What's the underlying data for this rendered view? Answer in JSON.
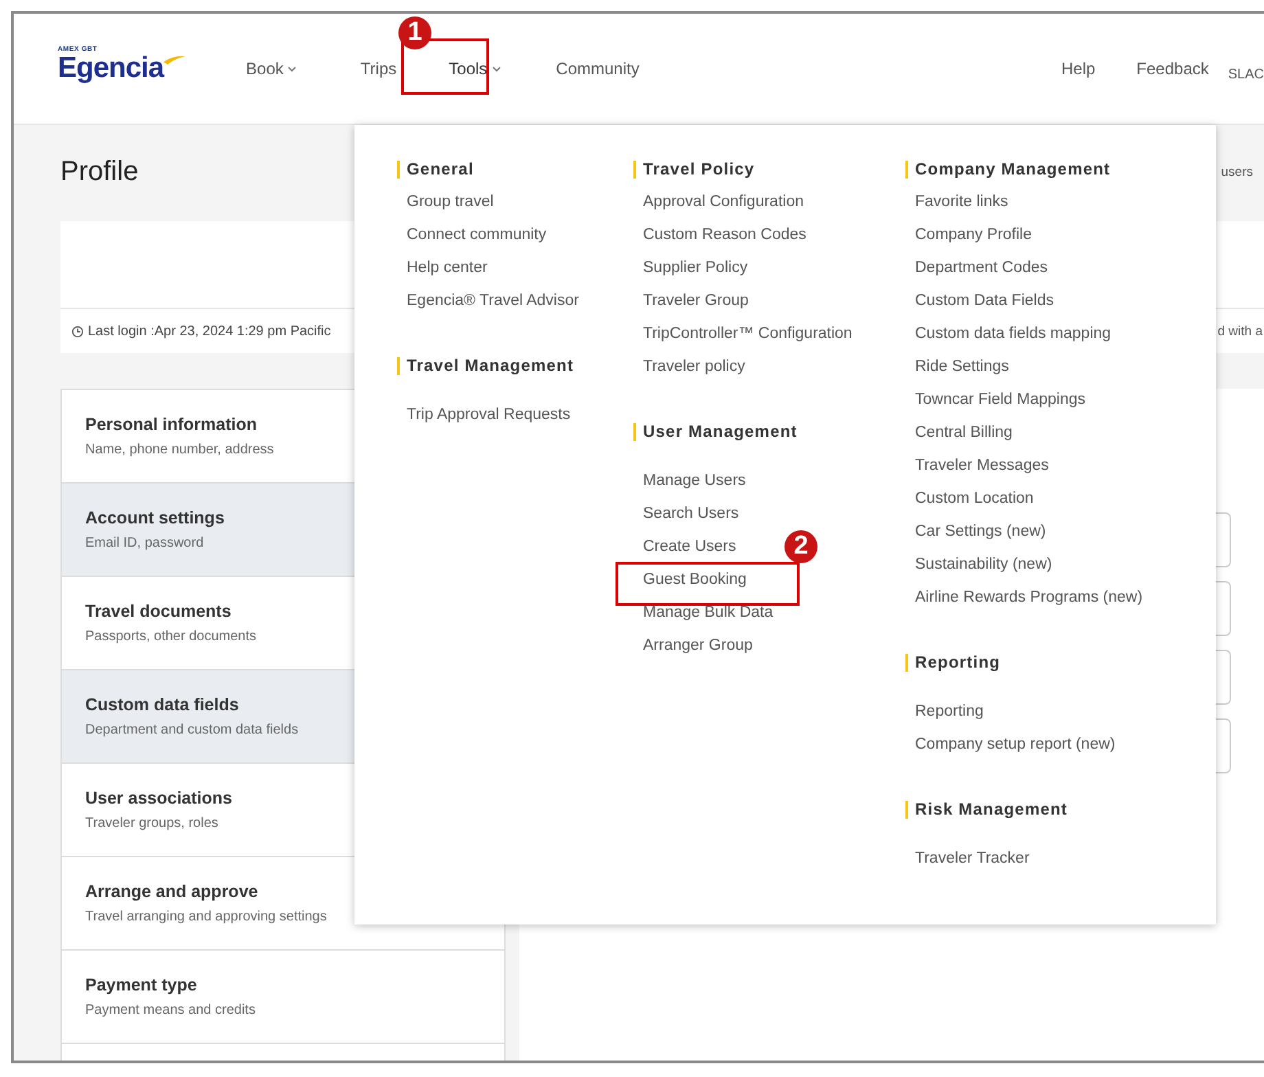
{
  "header": {
    "logo": {
      "tagline": "AMEX GBT",
      "name": "Egencia"
    },
    "nav": [
      {
        "label": "Book",
        "dropdown": true,
        "selected": false
      },
      {
        "label": "Trips",
        "dropdown": false,
        "selected": false
      },
      {
        "label": "Tools",
        "dropdown": true,
        "selected": true
      },
      {
        "label": "Community",
        "dropdown": false,
        "selected": false
      }
    ],
    "right_links": [
      "Help",
      "Feedback",
      "SLAC"
    ]
  },
  "page": {
    "title": "Profile",
    "header_right_text": "users",
    "last_login": "Last login :Apr 23, 2024 1:29 pm Pacific",
    "last_login_right_text": "d with a"
  },
  "sidebar": {
    "items": [
      {
        "title": "Personal information",
        "subtitle": "Name, phone number, address",
        "highlighted": false
      },
      {
        "title": "Account settings",
        "subtitle": "Email ID, password",
        "highlighted": true
      },
      {
        "title": "Travel documents",
        "subtitle": "Passports, other documents",
        "highlighted": false
      },
      {
        "title": "Custom data fields",
        "subtitle": "Department and custom data fields",
        "highlighted": true
      },
      {
        "title": "User associations",
        "subtitle": "Traveler groups, roles",
        "highlighted": false
      },
      {
        "title": "Arrange and approve",
        "subtitle": "Travel arranging and approving settings",
        "highlighted": false
      },
      {
        "title": "Payment type",
        "subtitle": "Payment means and credits",
        "highlighted": false
      }
    ]
  },
  "tools_menu": {
    "columns": [
      {
        "sections": [
          {
            "title": "General",
            "items": [
              "Group travel",
              "Connect community",
              "Help center",
              "Egencia® Travel Advisor"
            ]
          },
          {
            "title": "Travel Management",
            "items": [
              "Trip Approval Requests"
            ]
          }
        ]
      },
      {
        "sections": [
          {
            "title": "Travel Policy",
            "items": [
              "Approval Configuration",
              "Custom Reason Codes",
              "Supplier Policy",
              "Traveler Group",
              "TripController™ Configuration",
              "Traveler policy"
            ]
          },
          {
            "title": "User Management",
            "items": [
              "Manage Users",
              "Search Users",
              "Create Users",
              "Guest Booking",
              "Manage Bulk Data",
              "Arranger Group"
            ]
          }
        ]
      },
      {
        "sections": [
          {
            "title": "Company Management",
            "items": [
              "Favorite links",
              "Company Profile",
              "Department Codes",
              "Custom Data Fields",
              "Custom data fields mapping",
              "Ride Settings",
              "Towncar Field Mappings",
              "Central Billing",
              "Traveler Messages",
              "Custom Location",
              "Car Settings (new)",
              "Sustainability (new)",
              "Airline Rewards Programs (new)"
            ]
          },
          {
            "title": "Reporting",
            "items": [
              "Reporting",
              "Company setup report (new)"
            ]
          },
          {
            "title": "Risk Management",
            "items": [
              "Traveler Tracker"
            ]
          }
        ]
      }
    ]
  },
  "annotations": [
    {
      "number": "1"
    },
    {
      "number": "2"
    }
  ]
}
